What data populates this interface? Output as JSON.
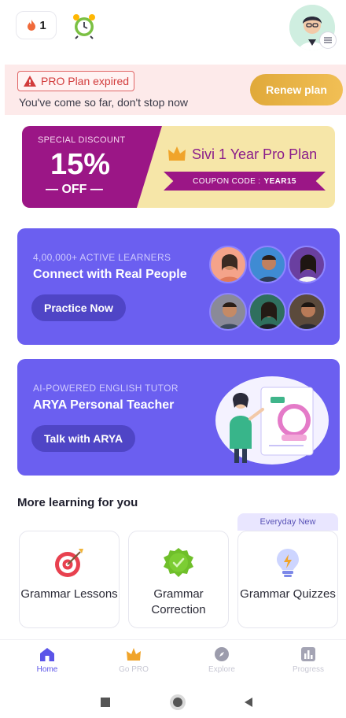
{
  "topbar": {
    "streak_count": "1",
    "icons": {
      "streak": "flame-icon",
      "alarm": "alarm-clock-icon",
      "profile": "user-avatar"
    }
  },
  "pro_banner": {
    "expired_label": "PRO Plan expired",
    "message": "You've come so far, don't stop now",
    "renew_label": "Renew plan"
  },
  "discount": {
    "kicker": "SPECIAL DISCOUNT",
    "percent": "15%",
    "off_label": "— OFF —",
    "plan_title": "Sivi 1 Year Pro Plan",
    "coupon_prefix": "COUPON CODE :",
    "coupon_code": "YEAR15",
    "colors": {
      "accent": "#9b1686",
      "background": "#f6e6a8"
    }
  },
  "practice_card": {
    "kicker": "4,00,000+ ACTIVE LEARNERS",
    "title": "Connect with Real People",
    "button_label": "Practice Now"
  },
  "arya_card": {
    "kicker": "AI-POWERED ENGLISH TUTOR",
    "title": "ARYA Personal Teacher",
    "button_label": "Talk with ARYA"
  },
  "more_learning": {
    "title": "More learning for you",
    "badge": "Everyday New",
    "items": [
      {
        "label": "Grammar Lessons",
        "icon": "target-icon"
      },
      {
        "label": "Grammar Correction",
        "icon": "check-badge-icon"
      },
      {
        "label": "Grammar Quizzes",
        "icon": "lightbulb-icon"
      }
    ]
  },
  "bottom_nav": {
    "items": [
      {
        "label": "Home",
        "icon": "home-icon",
        "active": true
      },
      {
        "label": "Go PRO",
        "icon": "crown-icon",
        "active": false
      },
      {
        "label": "Explore",
        "icon": "compass-icon",
        "active": false
      },
      {
        "label": "Progress",
        "icon": "bar-chart-icon",
        "active": false
      }
    ]
  },
  "colors": {
    "primary": "#6b5ff0",
    "gold": "#e0a93a",
    "danger": "#d23c3c"
  }
}
